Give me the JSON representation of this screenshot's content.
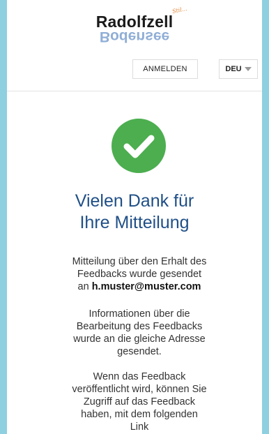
{
  "header": {
    "logo_text": "Radolfzell",
    "logo_mirror": "Bodensee",
    "logo_tagline": "Stil...",
    "login_label": "ANMELDEN",
    "language": "DEU"
  },
  "main": {
    "success_icon": "check-icon",
    "title_line1": "Vielen Dank für",
    "title_line2": "Ihre Mitteilung",
    "para1_line1": "Mitteilung über den Erhalt des",
    "para1_line2": "Feedbacks wurde gesendet",
    "para1_prefix": "an ",
    "email": "h.muster@muster.com",
    "para2_line1": "Informationen über die",
    "para2_line2": "Bearbeitung des Feedbacks",
    "para2_line3": "wurde an die gleiche Adresse",
    "para2_line4": "gesendet.",
    "para3_line1": "Wenn das Feedback",
    "para3_line2": "veröffentlicht wird, können Sie",
    "para3_line3": "Zugriff auf das Feedback",
    "para3_line4": "haben, mit dem folgenden",
    "para3_line5": "Link"
  },
  "colors": {
    "background": "#8ecfe0",
    "success_green": "#4cae4f",
    "title_blue": "#1f4f87"
  }
}
